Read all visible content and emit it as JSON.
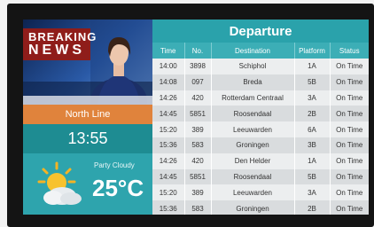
{
  "news": {
    "line1": "BREAKING",
    "line2": "NEWS"
  },
  "line_name": "North Line",
  "clock": "13:55",
  "weather": {
    "condition": "Party Cloudy",
    "temperature": "25°C",
    "icon": "partly-cloudy-icon"
  },
  "board": {
    "title": "Departure",
    "headers": [
      "Time",
      "No.",
      "Destination",
      "Platform",
      "Status"
    ],
    "rows": [
      [
        "14:00",
        "3898",
        "Schiphol",
        "1A",
        "On Time"
      ],
      [
        "14:08",
        "097",
        "Breda",
        "5B",
        "On Time"
      ],
      [
        "14:26",
        "420",
        "Rotterdam Centraal",
        "3A",
        "On Time"
      ],
      [
        "14:45",
        "5851",
        "Roosendaal",
        "2B",
        "On Time"
      ],
      [
        "15:20",
        "389",
        "Leeuwarden",
        "6A",
        "On Time"
      ],
      [
        "15:36",
        "583",
        "Groningen",
        "3B",
        "On Time"
      ],
      [
        "14:26",
        "420",
        "Den Helder",
        "1A",
        "On Time"
      ],
      [
        "14:45",
        "5851",
        "Roosendaal",
        "5B",
        "On Time"
      ],
      [
        "15:20",
        "389",
        "Leeuwarden",
        "3A",
        "On Time"
      ],
      [
        "15:36",
        "583",
        "Groningen",
        "2B",
        "On Time"
      ]
    ]
  },
  "colors": {
    "teal": "#2aa2ab",
    "orange": "#e0833c",
    "dark_teal": "#1e8c92"
  }
}
